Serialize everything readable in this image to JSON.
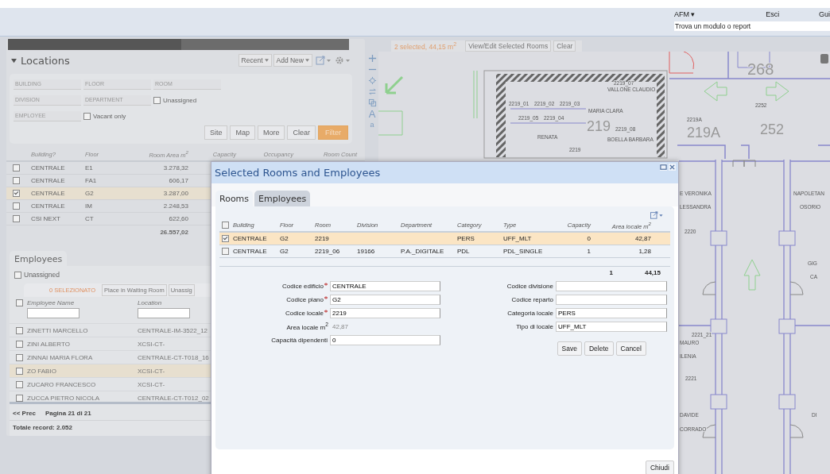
{
  "header": {
    "menu": "AFM ▾",
    "logout": "Esci",
    "help": "Gui",
    "search": {
      "placeholder": "Trova un modulo o report"
    }
  },
  "locations": {
    "title": "Locations",
    "toolbar": [
      "Recent",
      "Add New"
    ],
    "filters": [
      {
        "placeholder": "BUILDING"
      },
      {
        "placeholder": "FLOOR"
      },
      {
        "placeholder": "ROOM"
      },
      {
        "placeholder": "DIVISION"
      },
      {
        "placeholder": "DEPARTMENT"
      },
      {
        "placeholder": "EMPLOYEE"
      }
    ],
    "checkboxes": [
      {
        "label": "Unassigned",
        "checked": false
      },
      {
        "label": "Vacant only",
        "checked": false
      }
    ],
    "buttons": [
      {
        "label": "Site",
        "primary": false
      },
      {
        "label": "Map",
        "primary": false
      },
      {
        "label": "More",
        "primary": false
      },
      {
        "label": "Clear",
        "primary": false
      },
      {
        "label": "Filter",
        "primary": true
      }
    ],
    "columns": [
      "Building?",
      "Floor",
      "Room Area m$^{2}$",
      "Capacity",
      "Occupancy",
      "Room Count"
    ],
    "rows": [
      {
        "building": "CENTRALE",
        "floor": "E1",
        "area": "3.278,32",
        "selected": false
      },
      {
        "building": "CENTRALE",
        "floor": "FA1",
        "area": "606,17",
        "selected": false
      },
      {
        "building": "CENTRALE",
        "floor": "G2",
        "area": "3.287,00",
        "selected": true
      },
      {
        "building": "CENTRALE",
        "floor": "IM",
        "area": "2.248,53",
        "selected": false
      },
      {
        "building": "CSI NEXT",
        "floor": "CT",
        "area": "622,60",
        "selected": false
      }
    ],
    "total": "26.557,02"
  },
  "employees": {
    "tab": "Employees",
    "unassigned": {
      "label": "Unassigned",
      "checked": false
    },
    "selected_count": "0 SELEZIONATO",
    "actions": [
      "Place in Waiting Room",
      "Unassig"
    ],
    "select_all_checked": false,
    "columns": [
      "Employee Name",
      "Location"
    ],
    "rows": [
      {
        "name": "ZINETTI MARCELLO",
        "location": "CENTRALE-IM-3522_12",
        "selected": false
      },
      {
        "name": "ZINI ALBERTO",
        "location": "XCSI-CT-",
        "selected": false
      },
      {
        "name": "ZINNAI MARIA FLORA",
        "location": "CENTRALE-CT-T018_16",
        "selected": false
      },
      {
        "name": "ZO FABIO",
        "location": "XCSI-CT-",
        "selected": true
      },
      {
        "name": "ZUCARO FRANCESCO",
        "location": "XCSI-CT-",
        "selected": false
      },
      {
        "name": "ZUCCA PIETRO NICOLA",
        "location": "CENTRALE-CT-T012_02",
        "selected": false
      }
    ],
    "prev": "<< Prec",
    "page": "Pagina 21 di 21",
    "total": "Totale record: 2.052"
  },
  "map": {
    "selection": "2 selected, 44,15 m$^{2}$",
    "buttons": [
      "View/Edit Selected Rooms",
      "Clear"
    ],
    "text_tools": [
      "A",
      "a"
    ],
    "labels": [
      "268",
      "2219_07",
      "VALLONE CLAUDIO",
      "2219_01",
      "2219_02",
      "2219_03",
      "2252",
      "MARIA CLARA",
      "2219_05",
      "2219_04",
      "219",
      "2219A",
      "RENATA",
      "2219_08",
      "219A",
      "252",
      "BOELLA BARBARA",
      "2219",
      "E VERONIKA",
      "NAPOLETAN",
      "LESSANDRA",
      "OSORIO",
      "2220",
      "GIG",
      "CA",
      "2221_21",
      "MAURO",
      "ILENIA",
      "2221",
      "DAVIDE",
      "DI",
      "CORRADO"
    ]
  },
  "dialog": {
    "title": "Selected Rooms and Employees",
    "tabs": [
      {
        "label": "Rooms",
        "selected": true
      },
      {
        "label": "Employees",
        "selected": false
      }
    ],
    "select_all_checked": false,
    "columns": [
      "Building",
      "Floor",
      "Room",
      "Division",
      "Department",
      "Category",
      "Type",
      "Capacity",
      "Area locale m$^{2}$"
    ],
    "rows": [
      {
        "cells": [
          "CENTRALE",
          "G2",
          "2219",
          "",
          "",
          "PERS",
          "UFF_MLT",
          "0",
          "42,87"
        ],
        "checked": true,
        "selected": true
      },
      {
        "cells": [
          "CENTRALE",
          "G2",
          "2219_06",
          "19166",
          "P.A._DIGITALE",
          "PDL",
          "PDL_SINGLE",
          "1",
          "1,28"
        ],
        "checked": false,
        "selected": false
      }
    ],
    "totals": [
      "1",
      "44,15"
    ],
    "form_left": [
      {
        "label": "Codice edificio",
        "required": true,
        "kind": "input",
        "value": "CENTRALE"
      },
      {
        "label": "Codice piano",
        "required": true,
        "kind": "input",
        "value": "G2"
      },
      {
        "label": "Codice locale",
        "required": true,
        "kind": "input",
        "value": "2219"
      },
      {
        "label": "Area locale m$^{2}$",
        "required": false,
        "kind": "readonly",
        "value": "42,87"
      },
      {
        "label": "Capacità dipendenti",
        "required": false,
        "kind": "input",
        "value": "0"
      }
    ],
    "form_right": [
      {
        "label": "Codice divisione",
        "required": false,
        "kind": "input"
      },
      {
        "label": "Codice reparto",
        "required": false,
        "kind": "input"
      },
      {
        "label": "Categoria locale",
        "required": false,
        "kind": "input",
        "value": "PERS"
      },
      {
        "label": "Tipo di locale",
        "required": false,
        "kind": "input",
        "value": "UFF_MLT"
      }
    ],
    "buttons": [
      "Save",
      "Delete",
      "Cancel"
    ],
    "close": "Chiudi"
  }
}
